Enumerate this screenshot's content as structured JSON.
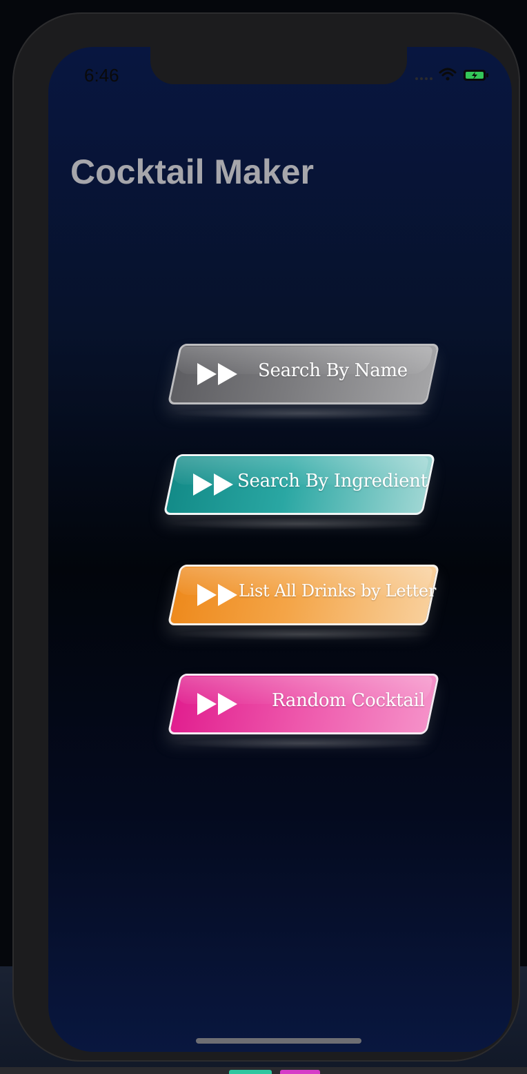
{
  "status_bar": {
    "time": "6:46",
    "wifi_icon": "wifi-icon",
    "battery_icon": "battery-charging-icon",
    "battery_color": "#34c759"
  },
  "nav": {
    "title": "Cocktail Maker"
  },
  "menu": [
    {
      "label": "Search By Name",
      "icon": "fast-forward-icon",
      "color": "#7b7b7e"
    },
    {
      "label": "Search By Ingredient",
      "icon": "fast-forward-icon",
      "color": "#1d9a96"
    },
    {
      "label": "List All Drinks by Letter",
      "icon": "fast-forward-icon",
      "color": "#f29634"
    },
    {
      "label": "Random Cocktail",
      "icon": "fast-forward-icon",
      "color": "#e52f97"
    }
  ],
  "colors": {
    "background_top": "#081640",
    "background_mid": "#02050b",
    "title": "#a6a6ab"
  }
}
